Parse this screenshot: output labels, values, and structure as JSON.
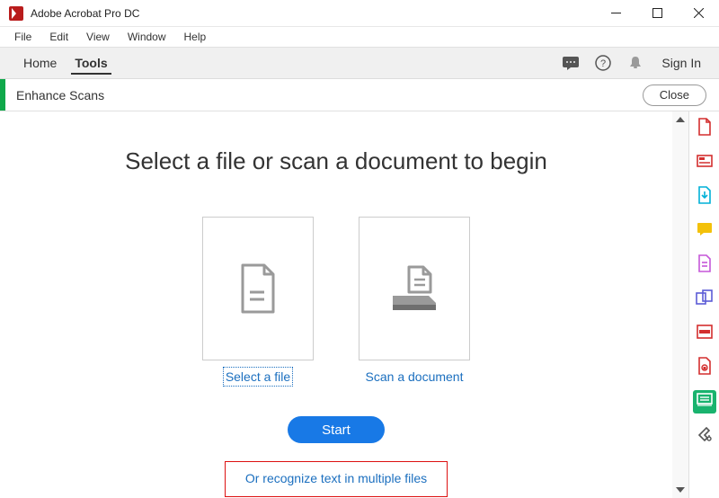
{
  "titlebar": {
    "title": "Adobe Acrobat Pro DC"
  },
  "menubar": {
    "items": [
      "File",
      "Edit",
      "View",
      "Window",
      "Help"
    ]
  },
  "toolbar": {
    "tabs": {
      "home": "Home",
      "tools": "Tools"
    },
    "signin": "Sign In"
  },
  "subbar": {
    "title": "Enhance Scans",
    "close": "Close"
  },
  "main": {
    "headline": "Select a file or scan a document to begin",
    "select_file": "Select a file",
    "scan_document": "Scan a document",
    "start": "Start",
    "alt_link": "Or recognize text in multiple files"
  },
  "rail": {
    "items": [
      {
        "name": "create-pdf-icon",
        "color": "#d32f2f"
      },
      {
        "name": "edit-pdf-icon",
        "color": "#d32f2f"
      },
      {
        "name": "export-pdf-icon",
        "color": "#00b1d7"
      },
      {
        "name": "comment-icon",
        "color": "#f3c10a"
      },
      {
        "name": "organize-pages-icon",
        "color": "#c557d8"
      },
      {
        "name": "combine-files-icon",
        "color": "#5b5bd6"
      },
      {
        "name": "redact-icon",
        "color": "#d32f2f"
      },
      {
        "name": "protect-icon",
        "color": "#d32f2f"
      },
      {
        "name": "enhance-scans-icon",
        "color": "#ffffff",
        "active": true
      },
      {
        "name": "more-tools-icon",
        "color": "#555555"
      }
    ]
  }
}
